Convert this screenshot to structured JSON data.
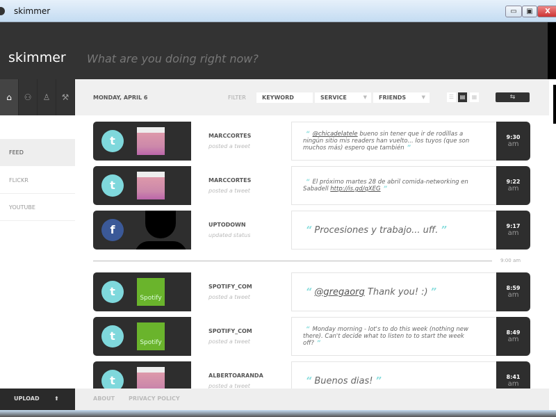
{
  "window": {
    "title": "skimmer",
    "minimize": "▭",
    "maximize": "▣",
    "close": "X"
  },
  "header": {
    "brand": "skimmer",
    "status_placeholder": "What are you doing right now?"
  },
  "nav": {
    "icons": [
      "home-icon",
      "friends-icon",
      "person-icon",
      "wrench-icon"
    ]
  },
  "toolbar": {
    "date": "MONDAY, APRIL 6",
    "filter_label": "FILTER",
    "keyword": "KEYWORD",
    "service": "SERVICE",
    "friends": "FRIENDS",
    "refresh_icon": "⇆"
  },
  "sidebar": {
    "items": [
      {
        "label": "FEED",
        "active": true
      },
      {
        "label": "FLICKR"
      },
      {
        "label": "YOUTUBE"
      }
    ]
  },
  "colors": {
    "twitter": "#7fd8dc",
    "facebook": "#3b5998",
    "spotify": "#6ab42c",
    "dark": "#2e2e2e"
  },
  "feed": [
    {
      "service": "twitter",
      "user": "MARCCORTES",
      "action": "posted a tweet",
      "mention": "@chicadelatele",
      "text": " bueno sin tener que ir de rodillas a ningún sitio mis readers han vuelto... los tuyos (que son muchos más) espero que también",
      "time": "9:30",
      "ampm": "am"
    },
    {
      "service": "twitter",
      "user": "MARCCORTES",
      "action": "posted a tweet",
      "text": "El próximo martes 28 de abril comida-networking en Sabadell ",
      "link": "http://is.gd/qXEG",
      "time": "9:22",
      "ampm": "am"
    },
    {
      "service": "facebook",
      "user": "UPTODOWN",
      "action": "updated status",
      "text": "Procesiones y trabajo... uff.",
      "time": "9:17",
      "ampm": "am"
    },
    {
      "service": "twitter",
      "user": "SPOTIFY_COM",
      "action": "posted a tweet",
      "mention": "@gregaorg",
      "text": " Thank you! :)",
      "avatar_text": "Spotify",
      "time": "8:59",
      "ampm": "am"
    },
    {
      "service": "twitter",
      "user": "SPOTIFY_COM",
      "action": "posted a tweet",
      "text": "Monday morning - lot's to do this week (nothing new there). Can't decide what to listen to to start the week off?",
      "avatar_text": "Spotify",
      "time": "8:49",
      "ampm": "am"
    },
    {
      "service": "twitter",
      "user": "ALBERTOARANDA",
      "action": "posted a tweet",
      "text": "Buenos dias!",
      "time": "8:41",
      "ampm": "am"
    }
  ],
  "divider_time": "9:00 am",
  "footer": {
    "upload": "UPLOAD",
    "about": "ABOUT",
    "privacy": "PRIVACY POLICY"
  }
}
